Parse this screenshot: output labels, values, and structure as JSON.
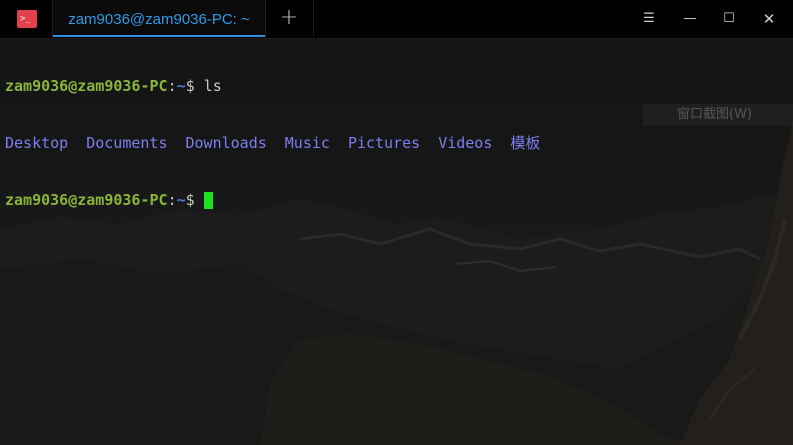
{
  "titlebar": {
    "app_icon_glyph": ">_",
    "tab_title": "zam9036@zam9036-PC: ~",
    "new_tab_glyph": "+",
    "menu_glyph": "☰",
    "minimize_glyph": "—",
    "maximize_glyph": "☐",
    "close_glyph": "✕",
    "icons": {
      "app": "terminal-icon",
      "new_tab": "plus-icon",
      "menu": "hamburger-menu-icon",
      "minimize": "minimize-icon",
      "maximize": "maximize-icon",
      "close": "close-icon"
    }
  },
  "terminal": {
    "lines": [
      {
        "user": "zam9036@zam9036-PC",
        "sep": ":",
        "path": "~",
        "dollar": "$",
        "command": " ls"
      },
      {
        "entries": [
          "Desktop",
          "Documents",
          "Downloads",
          "Music",
          "Pictures",
          "Videos",
          "模板"
        ]
      },
      {
        "user": "zam9036@zam9036-PC",
        "sep": ":",
        "path": "~",
        "dollar": "$"
      }
    ],
    "ghost_menu_text": "窗口截图(W)"
  },
  "colors": {
    "accent_tab": "#2d9bea",
    "prompt_user": "#8ab43a",
    "prompt_path": "#4f7ddf",
    "directory": "#7d7ef0",
    "cursor": "#1fe01f",
    "app_icon": "#e2404a"
  }
}
